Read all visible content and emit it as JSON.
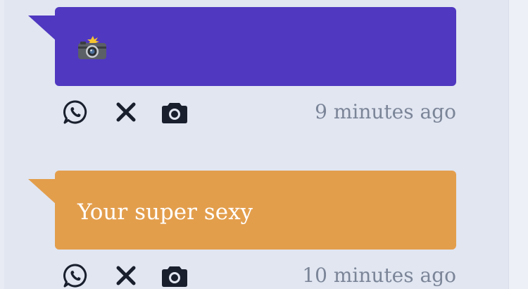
{
  "colors": {
    "background": "#e1e6f1",
    "icon": "#1a1f2e",
    "timestamp": "#7b8598"
  },
  "messages": [
    {
      "bubble_color": "#5038c0",
      "content": "",
      "content_icon": "camera-with-flash-emoji",
      "actions": [
        {
          "icon": "whatsapp-icon"
        },
        {
          "icon": "close-icon"
        },
        {
          "icon": "camera-icon"
        }
      ],
      "timestamp": "9 minutes ago"
    },
    {
      "bubble_color": "#e39e4c",
      "content": "Your super sexy",
      "actions": [
        {
          "icon": "whatsapp-icon"
        },
        {
          "icon": "close-icon"
        },
        {
          "icon": "camera-icon"
        }
      ],
      "timestamp": "10 minutes ago"
    }
  ]
}
